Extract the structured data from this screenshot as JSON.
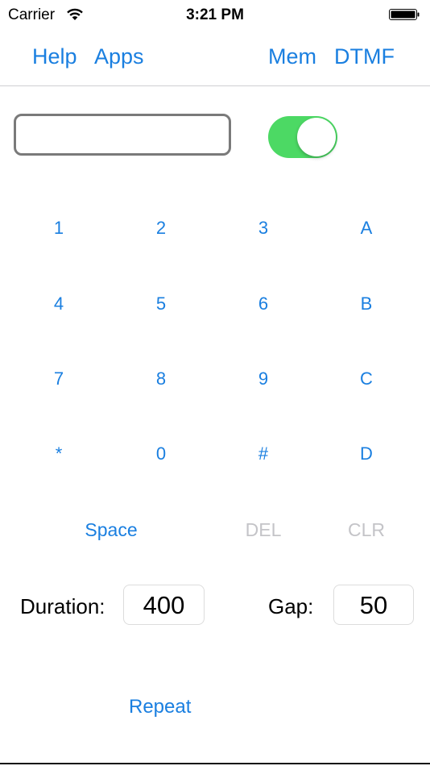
{
  "status_bar": {
    "carrier": "Carrier",
    "time": "3:21 PM",
    "wifi_icon": "wifi-icon",
    "battery_icon": "battery-icon"
  },
  "nav": {
    "help": "Help",
    "apps": "Apps",
    "mem": "Mem",
    "dtmf": "DTMF"
  },
  "tone_input": {
    "value": "",
    "placeholder": ""
  },
  "toggle": {
    "on": true,
    "color": "#4cd964"
  },
  "keypad": {
    "row1": [
      "1",
      "2",
      "3",
      "A"
    ],
    "row2": [
      "4",
      "5",
      "6",
      "B"
    ],
    "row3": [
      "7",
      "8",
      "9",
      "C"
    ],
    "row4": [
      "*",
      "0",
      "#",
      "D"
    ],
    "space": "Space",
    "del": "DEL",
    "clr": "CLR"
  },
  "settings": {
    "duration_label": "Duration:",
    "duration_value": "400",
    "gap_label": "Gap:",
    "gap_value": "50"
  },
  "repeat": "Repeat",
  "colors": {
    "accent": "#1a7fe0",
    "disabled": "#c4c4c8",
    "divider": "#cfcfd3"
  }
}
